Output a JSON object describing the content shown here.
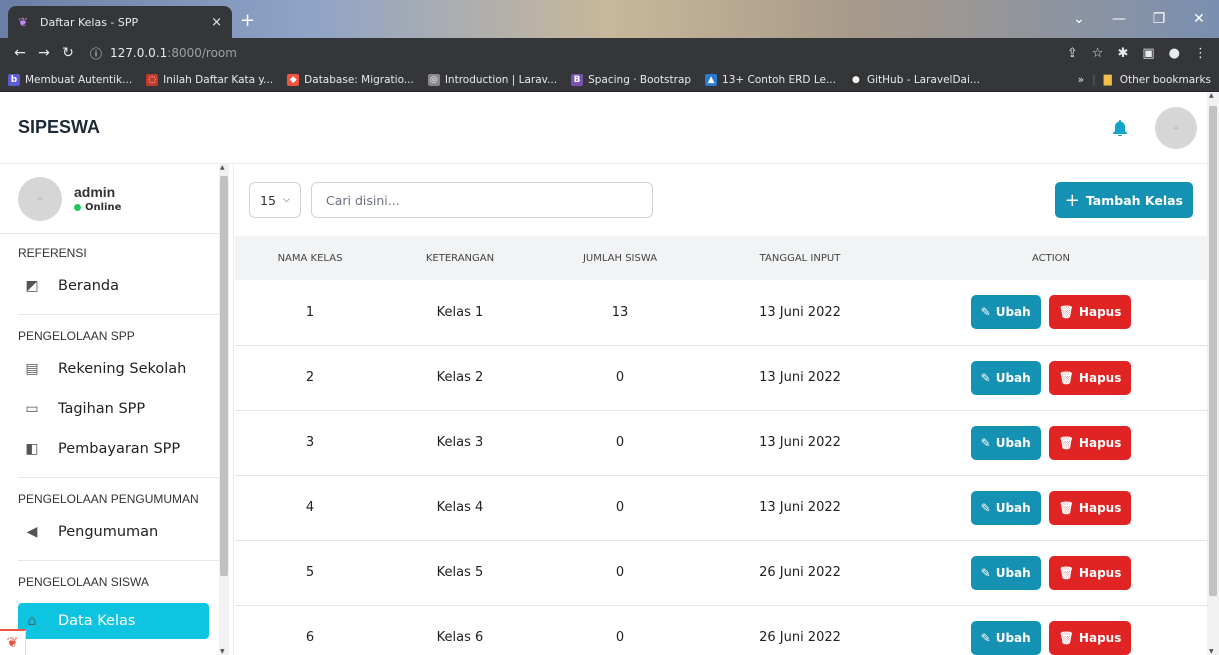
{
  "browser": {
    "tab_title": "Daftar Kelas - SPP",
    "tab_close": "×",
    "new_tab": "+",
    "url_host": "127.0.0.1",
    "url_path": ":8000/room",
    "bookmarks": [
      {
        "label": "Membuat Autentik...",
        "icon": "b",
        "color": "#5b5bd6"
      },
      {
        "label": "Inilah Daftar Kata y...",
        "icon": "◌",
        "color": "#c0392b"
      },
      {
        "label": "Database: Migratio...",
        "icon": "◆",
        "color": "#f05340"
      },
      {
        "label": "Introduction | Larav...",
        "icon": "◎",
        "color": "#888"
      },
      {
        "label": "Spacing · Bootstrap",
        "icon": "B",
        "color": "#7952b3"
      },
      {
        "label": "13+ Contoh ERD Le...",
        "icon": "▲",
        "color": "#2a7ad5"
      },
      {
        "label": "GitHub - LaravelDai...",
        "icon": "●",
        "color": "#333"
      }
    ],
    "more_bookmarks": "»",
    "other_bookmarks": "Other bookmarks"
  },
  "app": {
    "brand": "SIPESWA",
    "user": {
      "name": "admin",
      "status": "Online"
    }
  },
  "sidebar": {
    "sections": [
      {
        "title": "REFERENSI",
        "items": [
          {
            "label": "Beranda",
            "icon": "chalkboard-icon"
          }
        ]
      },
      {
        "title": "PENGELOLAAN SPP",
        "items": [
          {
            "label": "Rekening Sekolah",
            "icon": "document-icon"
          },
          {
            "label": "Tagihan SPP",
            "icon": "credit-card-icon"
          },
          {
            "label": "Pembayaran SPP",
            "icon": "money-icon"
          }
        ]
      },
      {
        "title": "PENGELOLAAN PENGUMUMAN",
        "items": [
          {
            "label": "Pengumuman",
            "icon": "megaphone-icon"
          }
        ]
      },
      {
        "title": "PENGELOLAAN SISWA",
        "items": [
          {
            "label": "Data Kelas",
            "icon": "building-icon",
            "active": true
          }
        ]
      }
    ]
  },
  "toolbar": {
    "per_page": "15",
    "search_placeholder": "Cari disini...",
    "add_label": "Tambah Kelas"
  },
  "table": {
    "headers": [
      "NAMA KELAS",
      "KETERANGAN",
      "JUMLAH SISWA",
      "TANGGAL INPUT",
      "ACTION"
    ],
    "rows": [
      {
        "nama": "1",
        "keterangan": "Kelas 1",
        "jumlah": "13",
        "tanggal": "13 Juni 2022"
      },
      {
        "nama": "2",
        "keterangan": "Kelas 2",
        "jumlah": "0",
        "tanggal": "13 Juni 2022"
      },
      {
        "nama": "3",
        "keterangan": "Kelas 3",
        "jumlah": "0",
        "tanggal": "13 Juni 2022"
      },
      {
        "nama": "4",
        "keterangan": "Kelas 4",
        "jumlah": "0",
        "tanggal": "13 Juni 2022"
      },
      {
        "nama": "5",
        "keterangan": "Kelas 5",
        "jumlah": "0",
        "tanggal": "26 Juni 2022"
      },
      {
        "nama": "6",
        "keterangan": "Kelas 6",
        "jumlah": "0",
        "tanggal": "26 Juni 2022"
      }
    ],
    "edit_label": "Ubah",
    "delete_label": "Hapus"
  },
  "colors": {
    "primary": "#1591b4",
    "danger": "#e02424",
    "active": "#0ec4e0",
    "online": "#22c55e"
  }
}
